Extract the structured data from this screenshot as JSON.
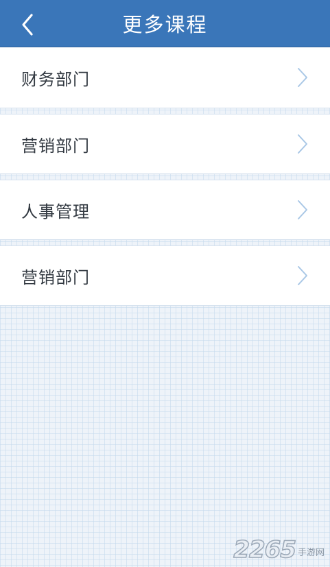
{
  "header": {
    "title": "更多课程",
    "back_icon": "chevron-left-icon",
    "background_color": "#3a76b9"
  },
  "list": {
    "items": [
      {
        "label": "财务部门",
        "icon": "chevron-right-icon"
      },
      {
        "label": "营销部门",
        "icon": "chevron-right-icon"
      },
      {
        "label": "人事管理",
        "icon": "chevron-right-icon"
      },
      {
        "label": "营销部门",
        "icon": "chevron-right-icon"
      }
    ]
  },
  "watermark": {
    "digits": "2265",
    "text": "手游网"
  }
}
